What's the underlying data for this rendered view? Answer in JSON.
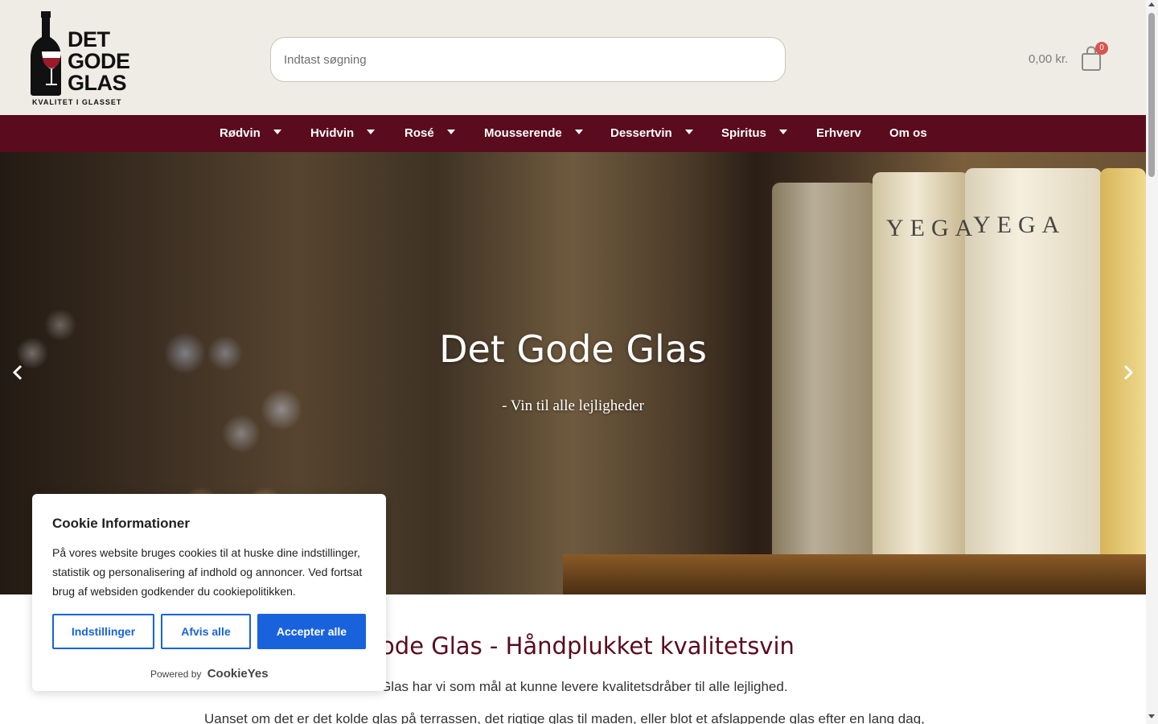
{
  "header": {
    "logo": {
      "line1": "DET",
      "line2": "GODE",
      "line3": "GLAS",
      "tagline": "KVALITET I GLASSET"
    },
    "search": {
      "placeholder": "Indtast søgning"
    },
    "cart": {
      "total": "0,00 kr.",
      "count": "0",
      "icon": "shopping-bag-icon"
    }
  },
  "nav": {
    "items": [
      {
        "label": "Rødvin",
        "has_dropdown": true
      },
      {
        "label": "Hvidvin",
        "has_dropdown": true
      },
      {
        "label": "Rosé",
        "has_dropdown": true
      },
      {
        "label": "Mousserende",
        "has_dropdown": true
      },
      {
        "label": "Dessertvin",
        "has_dropdown": true
      },
      {
        "label": "Spiritus",
        "has_dropdown": true
      },
      {
        "label": "Erhverv",
        "has_dropdown": false
      },
      {
        "label": "Om os",
        "has_dropdown": false
      }
    ]
  },
  "hero": {
    "title": "Det Gode Glas",
    "subtitle": "- Vin til alle lejligheder",
    "prev_icon": "chevron-left-icon",
    "next_icon": "chevron-right-icon",
    "bottle_label": "YEGA"
  },
  "content": {
    "heading": "t Gode Glas - Håndplukket kvalitetsvin",
    "paragraph1": "ode Glas har vi som mål at kunne levere kvalitetsdråber til alle lejlighed.",
    "paragraph2": "Uanset om det er det kolde glas på terrassen, det rigtige glas til maden, eller blot et afslappende glas efter en lang dag,"
  },
  "cookie_banner": {
    "title": "Cookie Informationer",
    "text": "På vores website bruges cookies til at huske dine indstillinger, statistik og personalisering af indhold og annoncer. Ved fortsat brug af websiden godkender du cookiepolitikken.",
    "settings_label": "Indstillinger",
    "reject_label": "Afvis alle",
    "accept_label": "Accepter alle",
    "powered_by": "Powered by",
    "brand": "CookieYes"
  },
  "colors": {
    "nav_bg": "#5a0c1e",
    "header_bg": "#efece6",
    "accent_blue": "#1863dc",
    "heading_color": "#5a0c1e"
  }
}
